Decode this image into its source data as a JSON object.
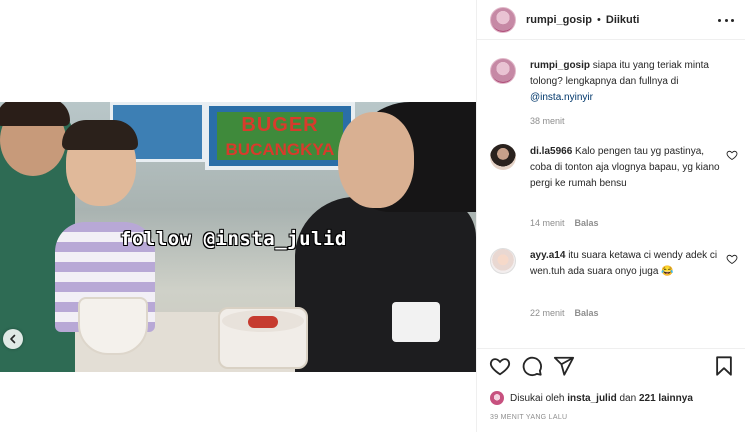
{
  "post": {
    "username": "rumpi_gosip",
    "follow_status": "Diikuti",
    "separator": "•"
  },
  "video": {
    "overlay_text": "follow @insta_julid",
    "sign_line1": "BUGER",
    "sign_line2": "BUCANGKYA"
  },
  "caption": {
    "username": "rumpi_gosip",
    "text": "siapa itu yang teriak minta tolong? lengkapnya dan fullnya di ",
    "mention": "@insta.nyinyir",
    "time": "38 menit"
  },
  "comments": [
    {
      "username": "di.la5966",
      "text": "Kalo pengen tau yg pastinya, coba di tonton aja vlognya bapau, yg kiano pergi ke rumah bensu",
      "time": "14 menit",
      "reply_label": "Balas"
    },
    {
      "username": "ayy.a14",
      "text": "itu suara ketawa ci wendy adek ci wen.tuh ada suara onyo juga",
      "emoji": "😂",
      "time": "22 menit",
      "reply_label": "Balas"
    }
  ],
  "likes": {
    "prefix": "Disukai oleh",
    "user": "insta_julid",
    "conjunction": "dan",
    "others": "221 lainnya"
  },
  "timestamp": "39 MENIT YANG LALU",
  "icons": [
    "more-icon",
    "heart-icon",
    "comment-icon",
    "share-icon",
    "bookmark-icon",
    "chevron-left-icon"
  ]
}
